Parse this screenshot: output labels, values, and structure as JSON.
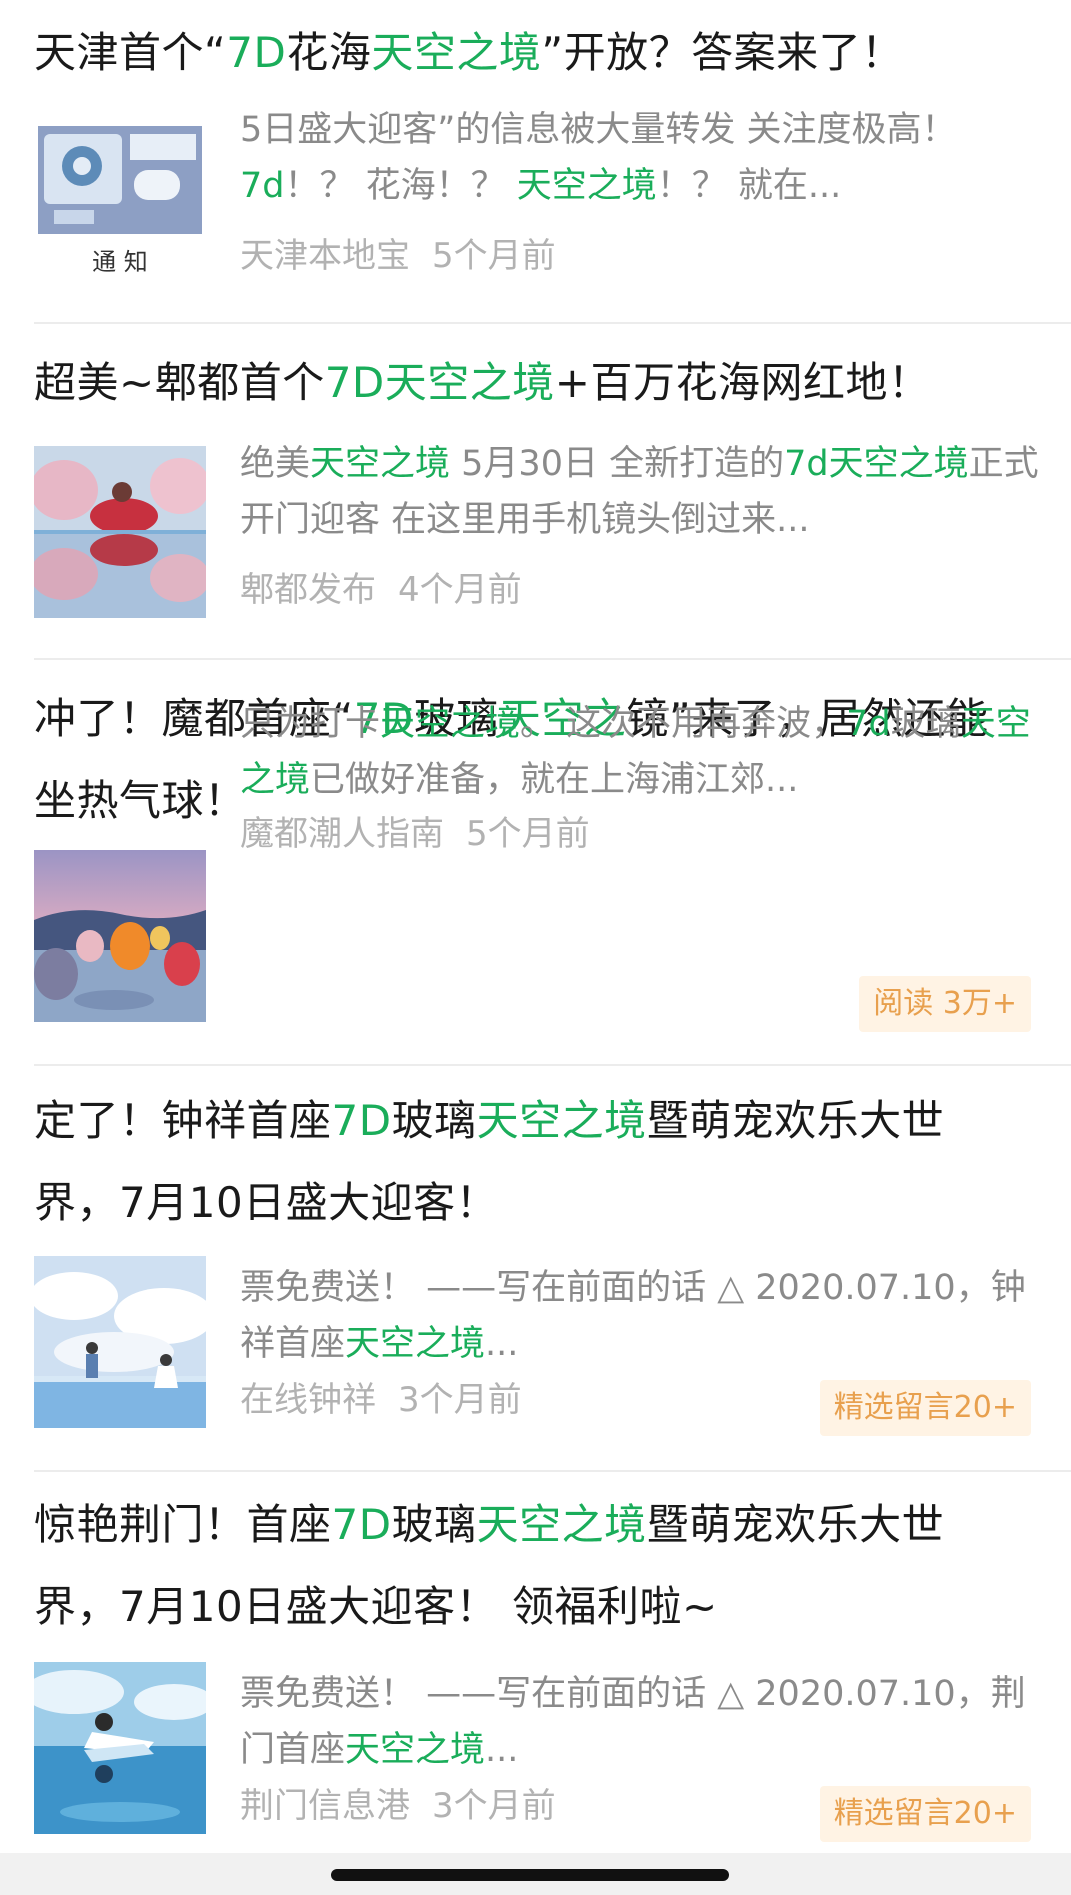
{
  "articles": [
    {
      "title": [
        {
          "t": "天津首个“"
        },
        {
          "t": "7D",
          "hl": true
        },
        {
          "t": "花海"
        },
        {
          "t": "天空之境",
          "hl": true
        },
        {
          "t": "”开放？答案来了！"
        }
      ],
      "snippet": [
        {
          "t": "5日盛大迎客”的信息被大量转发 关注度极高！"
        },
        {
          "t": "7d",
          "hl": true
        },
        {
          "t": "！？ 花海！？ "
        },
        {
          "t": "天空之境",
          "hl": true
        },
        {
          "t": "！？ 就在..."
        }
      ],
      "thumb": "notice-image",
      "thumb_caption": "通 知",
      "source": "天津本地宝",
      "time": "5个月前",
      "badge": ""
    },
    {
      "title": [
        {
          "t": "超美~郫都首个"
        },
        {
          "t": "7D天空之境",
          "hl": true
        },
        {
          "t": "+百万花海网红地！"
        }
      ],
      "snippet": [
        {
          "t": "绝美"
        },
        {
          "t": "天空之境",
          "hl": true
        },
        {
          "t": " 5月30日 全新打造的"
        },
        {
          "t": "7d天空之境",
          "hl": true
        },
        {
          "t": "正式开门迎客 在这里用手机镜头倒过来..."
        }
      ],
      "thumb": "flower-reflection-image",
      "source": "郫都发布",
      "time": "4个月前",
      "badge": ""
    },
    {
      "title": [
        {
          "t": "冲了！魔都首座“"
        },
        {
          "t": "7D",
          "hl": true
        },
        {
          "t": "玻璃"
        },
        {
          "t": "天空之",
          "hl": true
        },
        {
          "t": "镜”来了，居然还能坐热气球！"
        }
      ],
      "snippet": [
        {
          "t": "只为打卡"
        },
        {
          "t": "天空之境",
          "hl": true
        },
        {
          "t": "。 这次不用再奔波，"
        },
        {
          "t": "7d",
          "hl": true
        },
        {
          "t": "玻璃"
        },
        {
          "t": "天空之境",
          "hl": true
        },
        {
          "t": "已做好准备，就在上海浦江郊..."
        }
      ],
      "thumb": "hot-air-balloon-image",
      "source": "魔都潮人指南",
      "time": "5个月前",
      "badge": "阅读 3万+"
    },
    {
      "title": [
        {
          "t": "定了！钟祥首座"
        },
        {
          "t": "7D",
          "hl": true
        },
        {
          "t": "玻璃"
        },
        {
          "t": "天空之境",
          "hl": true
        },
        {
          "t": "暨萌宠欢乐大世界，7月10日盛大迎客！"
        }
      ],
      "snippet": [
        {
          "t": "票免费送！ ——写在前面的话 △ 2020.07.10，钟祥首座"
        },
        {
          "t": "天空之境",
          "hl": true
        },
        {
          "t": "..."
        }
      ],
      "thumb": "sky-glass-couple-image",
      "source": "在线钟祥",
      "time": "3个月前",
      "badge": "精选留言20+"
    },
    {
      "title": [
        {
          "t": "惊艳荆门！首座"
        },
        {
          "t": "7D",
          "hl": true
        },
        {
          "t": "玻璃"
        },
        {
          "t": "天空之境",
          "hl": true
        },
        {
          "t": "暨萌宠欢乐大世界，7月10日盛大迎客！ 领福利啦~"
        }
      ],
      "snippet": [
        {
          "t": "票免费送！ ——写在前面的话 △ 2020.07.10，荆门首座"
        },
        {
          "t": "天空之境",
          "hl": true
        },
        {
          "t": "..."
        }
      ],
      "thumb": "sky-glass-girl-image",
      "source": "荆门信息港",
      "time": "3个月前",
      "badge": "精选留言20+"
    }
  ]
}
